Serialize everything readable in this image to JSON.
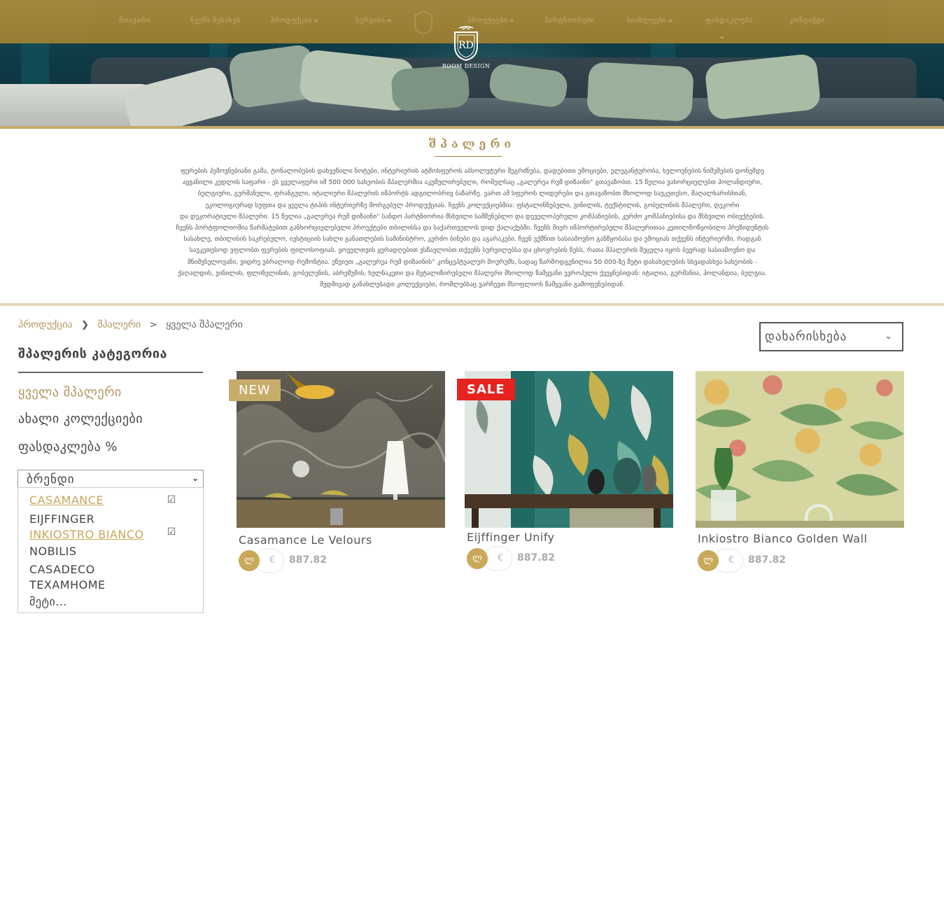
{
  "nav": {
    "items": [
      {
        "label": "მთავარი",
        "caret": ""
      },
      {
        "label": "ჩვენს შესახებ",
        "caret": ""
      },
      {
        "label": "პროდუქცია",
        "caret": "≡"
      },
      {
        "label": "სერვისი",
        "caret": "≡"
      },
      {
        "label": "პროექტები",
        "caret": "≡"
      },
      {
        "label": "პარტნიორები",
        "caret": ""
      },
      {
        "label": "სიახლეები",
        "caret": "≡"
      },
      {
        "label": "ფასდაკლება",
        "caret": ""
      },
      {
        "label": "კონტაქტი",
        "caret": ""
      }
    ],
    "chevron": "⌄",
    "logo_text": "ROOM DESIGN",
    "logo_monogram": "RD"
  },
  "intro": {
    "title": "შპალერი",
    "lines": [
      "ფერების ჰემოვნებიანი გამა, ტონალობების დახვეწილი ნოტები, ინტერიერის ატმოსფეროს აბსოლუტური შეგრძნება, დადებითი ემოციები, ელეგანტურობა, ხელოვნების ნიმუშების დონემდე",
      "აყვანილი კედლის საფარი - ეს ყველაფერი იმ 500 000 სახეობის შპალერშია აკუმულირებული, რომელსაც „გალერეა რუმ დიზაინი“ გთავაზობთ. 15 წელია ვახორციელებთ  ჰოლანდიური,",
      "ბელგიური, გერმანული, ფრანგული, იტალიური შპალერის იმპორტს ადგილობრივ ბაზარზე. ვართ ამ სფეროს ლიდერები და გთავაზობთ მხოლოდ საუკეთესო, მაღალხარისხიან,",
      "ეკოლოგიურად სუფთა და ყველა ტიპის ინტერიერზე მორგებულ პროდუქციას. ჩვენს კოლექციებშია: ფსტალინზებული, ვინილის, ტექსტილის, გობელინის შპალერი, დეკორი",
      "და დეკორატიული შპალერი. 15 წელია „გალერეა რუმ დიზაინი“ სანდო პარტნიორია მსხვილი სამშენებლო და დეველოპერული კომპანიების, კერძო კომპანიებისა და მსხვილი ობიექტების.",
      "ჩვენს პორტფოლიოშია წარმატებით განხორციელებული პროექტები თბილისსა და საქართველოს დიდ ქალაქებში. ჩვენს მიერ იმპორტირებული შპალერითაა კეთილმოწყობილი პრეზიდენტის",
      "სასახლე, თბილისის საკრებულო, იუსტიციის სახლი განათლების სამინისტრო, კერძო ბინები და აგარაკები. ჩვენ ვქმნით სასიამოვნო განწყობასა და ემოციას თქვენს ინტერიერში, რადგან",
      "საუკეთესოდ ვფლობთ ფერების ფილოსოფიას. ყოველთვის ყურადღებით ვსწავლობთ თქვენს სურვილებსა და ცხოვრების წესს, რათა შპალერის შეცვლა იყოს ბევრად სასიამოვნო და",
      "მნიშვნელოვანი, ვიდრე უბრალოდ რემონტია. ეწვიეთ „გალერეა რუმ დიზაინის“ კონცეპტუალურ შოურუმს, სადაც წარმოდგენილია 50 000-ზე მეტი დასახელების სხვადასხვა სახეობის -",
      "ქაღალდის, ვინილის, ფლიზელინის, გობელენის, აბრეშუმის, ხელნაკეთი და მეტალიზირებული შპალერი მხოლოდ წამყვანი ევროპული ქვეყნებიდან: იტალია, გერმანია, ჰოლანდია, ბელგია.",
      "მუდმივად განახლებადი კოლექციები, რომლებსაც ვარჩევთ მსოფლიოს წამყვანი გამოფენებიდან."
    ]
  },
  "breadcrumb": {
    "items": [
      "პროდუქცია",
      "შპალერი"
    ],
    "separators": [
      "❯",
      ">"
    ],
    "current": "ყველა შპალერი"
  },
  "sort": {
    "label": "დახარისხება",
    "chevron": "⌄"
  },
  "sidebar": {
    "title": "შპალერის კატეგორია",
    "links": [
      {
        "label": "ყველა შპალერი",
        "active": true
      },
      {
        "label": "ახალი კოლექციები",
        "active": false
      },
      {
        "label": "ფასდაკლება %",
        "active": false
      }
    ],
    "brand_select": {
      "label": "ბრენდი",
      "chevron": "⌄"
    },
    "brands": [
      {
        "label": "CASAMANCE",
        "selected": true,
        "check": "☑"
      },
      {
        "label": "EIJFFINGER",
        "selected": false,
        "check": ""
      },
      {
        "label": "INKIOSTRO BIANCO",
        "selected": true,
        "check": "☑"
      },
      {
        "label": "NOBILIS",
        "selected": false,
        "check": ""
      },
      {
        "label": "CASADECO",
        "selected": false,
        "check": ""
      },
      {
        "label": "TEXAMHOME",
        "selected": false,
        "check": ""
      },
      {
        "label": "მეტი...",
        "selected": false,
        "check": ""
      }
    ]
  },
  "products": [
    {
      "title": "Casamance  Le Velours",
      "badge": "NEW",
      "currency_gel": "ლ",
      "currency_eur": "€",
      "price": "887.82"
    },
    {
      "title": "Eijffinger  Unify",
      "badge": "SALE",
      "currency_gel": "ლ",
      "currency_eur": "€",
      "price": "887.82"
    },
    {
      "title": "Inkiostro Bianco   Golden Wall",
      "badge": "",
      "currency_gel": "ლ",
      "currency_eur": "€",
      "price": "887.82"
    }
  ],
  "colors": {
    "gold": "#b0955c",
    "nav_bg": "#9c7f31",
    "sale_red": "#e52320",
    "new_badge": "#c8ac6a"
  },
  "icons": [
    "chevron-down-icon",
    "checkbox-checked-icon",
    "logo-crest-icon",
    "breadcrumb-separator-icon"
  ]
}
